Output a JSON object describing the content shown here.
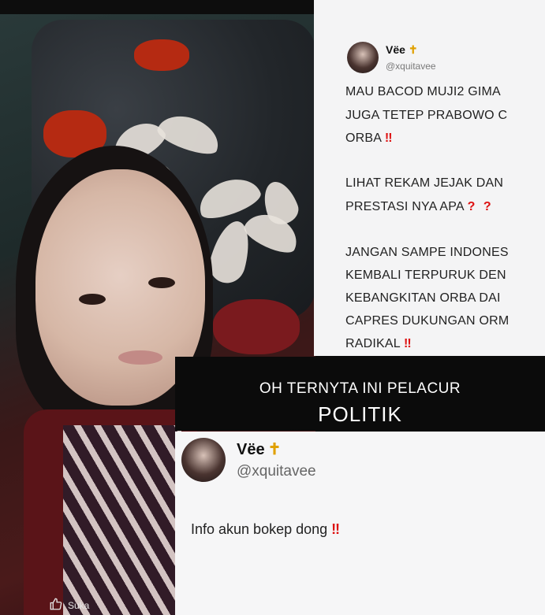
{
  "photo": {
    "like_label": "Suka",
    "like_icon": "thumbs-up-icon"
  },
  "tweet_top": {
    "display_name": "Vëe",
    "badge": "✝",
    "handle": "@xquitavee",
    "lines": [
      "MAU BACOD MUJI2 GIMA",
      "JUGA TETEP PRABOWO C",
      "ORBA",
      "LIHAT REKAM JEJAK DAN",
      "PRESTASI NYA APA",
      "JANGAN SAMPE INDONES",
      "KEMBALI TERPURUK DEN",
      "KEBANGKITAN ORBA DAI",
      "CAPRES DUKUNGAN ORM",
      "RADIKAL"
    ],
    "exclaim": "‼",
    "questions": "? ?"
  },
  "banner": {
    "line1": "OH TERNYTA INI PELACUR",
    "line2": "POLITIK"
  },
  "tweet_bottom": {
    "display_name": "Vëe",
    "badge": "✝",
    "handle": "@xquitavee",
    "text": "Info akun bokep dong",
    "exclaim": "‼"
  },
  "colors": {
    "accent_red": "#dd1111",
    "badge_gold": "#e0a000",
    "banner_bg": "#0b0b0b"
  }
}
